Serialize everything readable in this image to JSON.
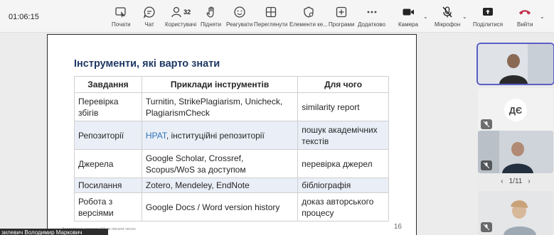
{
  "timer": "01:06:15",
  "toolbar": {
    "start": "Почати",
    "chat": "Чат",
    "users": "Користувачі",
    "users_count": "32",
    "raise": "Підняти",
    "react": "Реагувати",
    "view": "Переглянути",
    "elements": "Елементи ке...",
    "apps": "Програми",
    "more": "Додатково",
    "camera": "Камера",
    "mic": "Мікрофон",
    "share": "Поділитися",
    "leave": "Вийти"
  },
  "colors": {
    "accent": "#5b5fc7",
    "leave": "#c4314b",
    "title": "#1f3864",
    "link": "#2e75b6"
  },
  "slide": {
    "title": "Інструменти, які варто знати",
    "headers": [
      "Завдання",
      "Приклади інструментів",
      "Для чого"
    ],
    "rows": [
      {
        "task": "Перевірка збігів",
        "tools": "Turnitin, StrikePlagiarism, Unicheck, PlagiarismCheck",
        "purpose": "similarity report"
      },
      {
        "task": "Репозиторії",
        "tools_link": "НРАТ",
        "tools_rest": ", інституційні репозиторії",
        "purpose": "пошук академічних текстів"
      },
      {
        "task": "Джерела",
        "tools": "Google Scholar, Crossref, Scopus/WoS за доступом",
        "purpose": "перевірка джерел"
      },
      {
        "task": "Посилання",
        "tools": "Zotero, Mendeley, EndNote",
        "purpose": "бібліографія"
      },
      {
        "task": "Робота з версіями",
        "tools": "Google Docs / Word version history",
        "purpose": "доказ авторського процесу"
      }
    ],
    "footer": "Академічна система ШІ: як писати чесно",
    "page": "16"
  },
  "presenter_name": "зилевич Володимир Маркович",
  "participants": {
    "initials": "ДЄ",
    "pager": "1/11"
  }
}
